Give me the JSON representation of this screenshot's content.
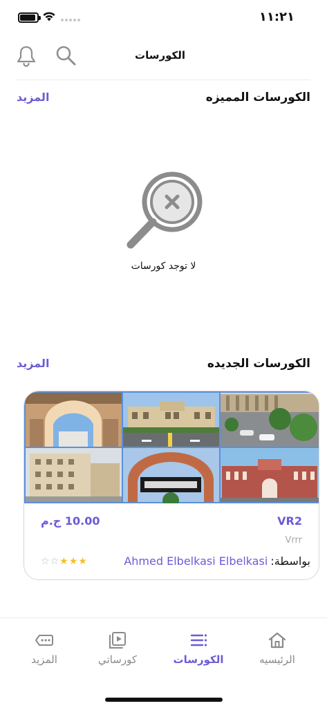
{
  "status_bar": {
    "time": "١١:٢١",
    "icons": [
      "battery-icon",
      "wifi-icon",
      "signal-icon"
    ]
  },
  "header": {
    "title": "الكورسات",
    "icons": [
      "bell-icon",
      "search-icon"
    ]
  },
  "featured_section": {
    "title": "الكورسات المميزه",
    "more_label": "المزيد",
    "empty_icon": "search-x-icon",
    "empty_message": "لا توجد كورسات"
  },
  "new_section": {
    "title": "الكورسات الجديده",
    "more_label": "المزيد",
    "courses": [
      {
        "title": "VR2",
        "price": "10.00 ج.م",
        "description": "Vrrr",
        "author_prefix": "بواسطة:",
        "author_name": "Ahmed Elbelkasi Elbelkasi",
        "rating": 3,
        "rating_max": 5,
        "image": "university-campus-collage"
      }
    ]
  },
  "tab_bar": {
    "tabs": [
      {
        "label": "المزيد",
        "icon": "more-icon",
        "active": false
      },
      {
        "label": "كورساتي",
        "icon": "my-courses-icon",
        "active": false
      },
      {
        "label": "الكورسات",
        "icon": "courses-list-icon",
        "active": true
      },
      {
        "label": "الرئيسيه",
        "icon": "home-icon",
        "active": false
      }
    ]
  },
  "colors": {
    "accent": "#6a5bd6",
    "star": "#f2c02c",
    "muted": "#8a8a8a"
  }
}
